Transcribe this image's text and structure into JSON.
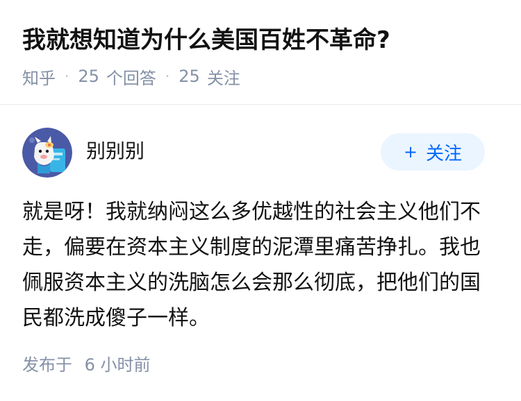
{
  "question": {
    "title": "我就想知道为什么美国百姓不革命?",
    "source": "知乎",
    "separator": "·",
    "answer_count": "25",
    "answer_label": "个回答",
    "follow_count": "25",
    "follow_label": "关注"
  },
  "answer": {
    "author_name": "别别别",
    "follow_button": {
      "icon_text": "+",
      "label": "关注"
    },
    "content": "就是呀！我就纳闷这么多优越性的社会主义他们不走，偏要在资本主义制度的泥潭里痛苦挣扎。我也佩服资本主义的洗脑怎么会那么彻底，把他们的国民都洗成傻子一样。",
    "posted_label": "发布于",
    "posted_time": "6 小时前"
  },
  "colors": {
    "title": "#121212",
    "meta": "#8590a6",
    "accent": "#0066ff",
    "follow_bg": "#ebf5ff",
    "divider": "#ebebeb",
    "avatar_bg": "#4b5aa6"
  }
}
